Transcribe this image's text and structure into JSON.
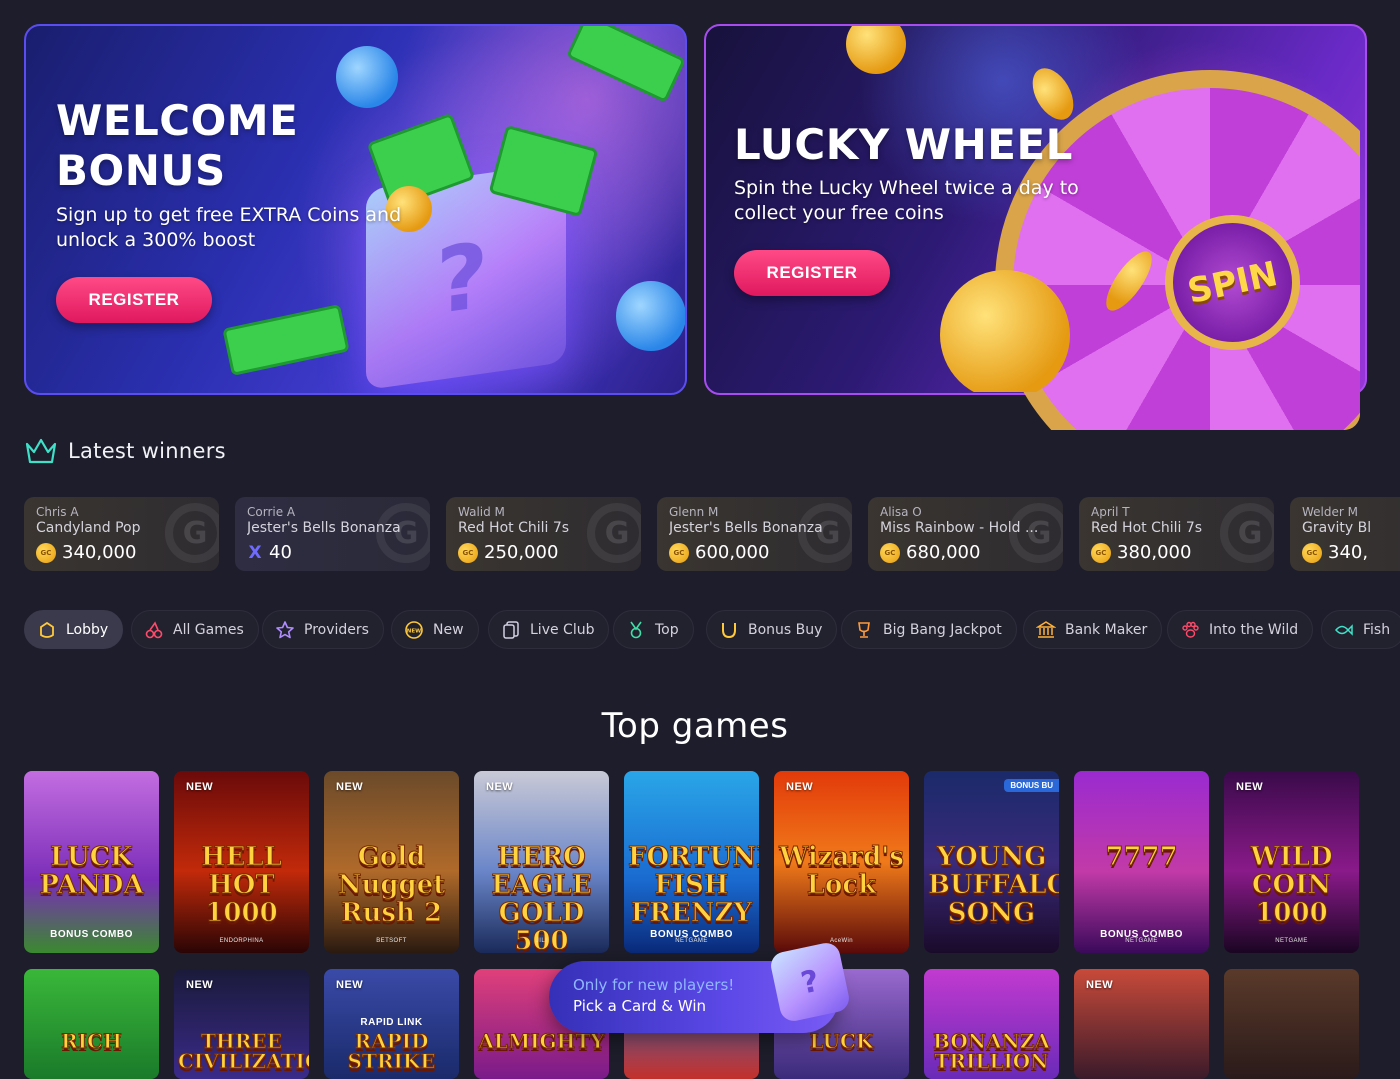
{
  "banners": {
    "welcome": {
      "title_line1": "WELCOME",
      "title_line2": "BONUS",
      "text_line1": "Sign up to get free EXTRA Coins and",
      "text_line2": "unlock a 300% boost",
      "button": "REGISTER"
    },
    "wheel": {
      "title": "LUCKY WHEEL",
      "text_line1": "Spin the Lucky Wheel twice a day to",
      "text_line2": "collect your free coins",
      "button": "REGISTER",
      "hub_label": "SPIN"
    }
  },
  "winners": {
    "heading": "Latest winners",
    "items": [
      {
        "name": "Chris A",
        "game": "Candyland Pop",
        "amount": "340,000",
        "currency": "gc",
        "style": "gold"
      },
      {
        "name": "Corrie A",
        "game": "Jester's Bells Bonanza",
        "amount": "40",
        "currency": "x",
        "style": "violet"
      },
      {
        "name": "Walid M",
        "game": "Red Hot Chili 7s",
        "amount": "250,000",
        "currency": "gc",
        "style": "gold"
      },
      {
        "name": "Glenn M",
        "game": "Jester's Bells Bonanza",
        "amount": "600,000",
        "currency": "gc",
        "style": "gold"
      },
      {
        "name": "Alisa O",
        "game": "Miss Rainbow - Hold ...",
        "amount": "680,000",
        "currency": "gc",
        "style": "gold"
      },
      {
        "name": "April T",
        "game": "Red Hot Chili 7s",
        "amount": "380,000",
        "currency": "gc",
        "style": "gold"
      },
      {
        "name": "Welder M",
        "game": "Gravity Bl",
        "amount": "340,",
        "currency": "gc",
        "style": "gold"
      }
    ],
    "currency_icon_label": "GC"
  },
  "categories": [
    {
      "label": "Lobby",
      "icon": "lobby-icon",
      "active": true
    },
    {
      "label": "All Games",
      "icon": "cherries-icon",
      "active": false
    },
    {
      "label": "Providers",
      "icon": "star-icon",
      "active": false
    },
    {
      "label": "New",
      "icon": "new-badge-icon",
      "active": false
    },
    {
      "label": "Live Club",
      "icon": "cards-icon",
      "active": false
    },
    {
      "label": "Top",
      "icon": "medal-icon",
      "active": false
    },
    {
      "label": "Bonus Buy",
      "icon": "horseshoe-icon",
      "active": false
    },
    {
      "label": "Big Bang Jackpot",
      "icon": "trophy-icon",
      "active": false
    },
    {
      "label": "Bank Maker",
      "icon": "bank-icon",
      "active": false
    },
    {
      "label": "Into the Wild",
      "icon": "paw-icon",
      "active": false
    },
    {
      "label": "Fish",
      "icon": "fish-icon",
      "active": false
    }
  ],
  "top_games": {
    "heading": "Top games",
    "new_label": "NEW",
    "row1": [
      {
        "name": "LUCK PANDA",
        "sub": "BONUS COMBO",
        "provider": "",
        "new": false,
        "bonus": ""
      },
      {
        "name": "HELL HOT 1000",
        "sub": "",
        "provider": "ENDORPHINA",
        "new": true,
        "bonus": ""
      },
      {
        "name": "Gold Nugget Rush 2",
        "sub": "",
        "provider": "BETSOFT",
        "new": true,
        "bonus": ""
      },
      {
        "name": "HERO EAGLE GOLD 500",
        "sub": "",
        "provider": "JILI",
        "new": true,
        "bonus": ""
      },
      {
        "name": "FORTUNE FISH FRENZY",
        "sub": "BONUS COMBO",
        "provider": "NETGAME",
        "new": false,
        "bonus": ""
      },
      {
        "name": "Wizard's Lock",
        "sub": "",
        "provider": "AceWin",
        "new": true,
        "bonus": ""
      },
      {
        "name": "YOUNG BUFFALO SONG",
        "sub": "",
        "provider": "",
        "new": false,
        "bonus": "BONUS BU"
      },
      {
        "name": "7777",
        "sub": "BONUS COMBO",
        "provider": "NETGAME",
        "new": false,
        "bonus": ""
      },
      {
        "name": "WILD COIN 1000",
        "sub": "",
        "provider": "NETGAME",
        "new": true,
        "bonus": ""
      }
    ],
    "row2": [
      {
        "name": "RICH",
        "new": false
      },
      {
        "name": "THREE CIVILIZATIONS",
        "new": true
      },
      {
        "name": "RAPID STRIKE",
        "sub": "RAPID LINK",
        "new": true
      },
      {
        "name": "ALMIGHTY",
        "new": false
      },
      {
        "name": "",
        "new": false
      },
      {
        "name": "LUCK",
        "new": false
      },
      {
        "name": "BONANZA TRILLION",
        "new": false
      },
      {
        "name": "",
        "new": true
      },
      {
        "name": "",
        "new": false
      }
    ]
  },
  "promo": {
    "line1": "Only for new players!",
    "line2": "Pick a Card & Win",
    "gift_mark": "?"
  }
}
